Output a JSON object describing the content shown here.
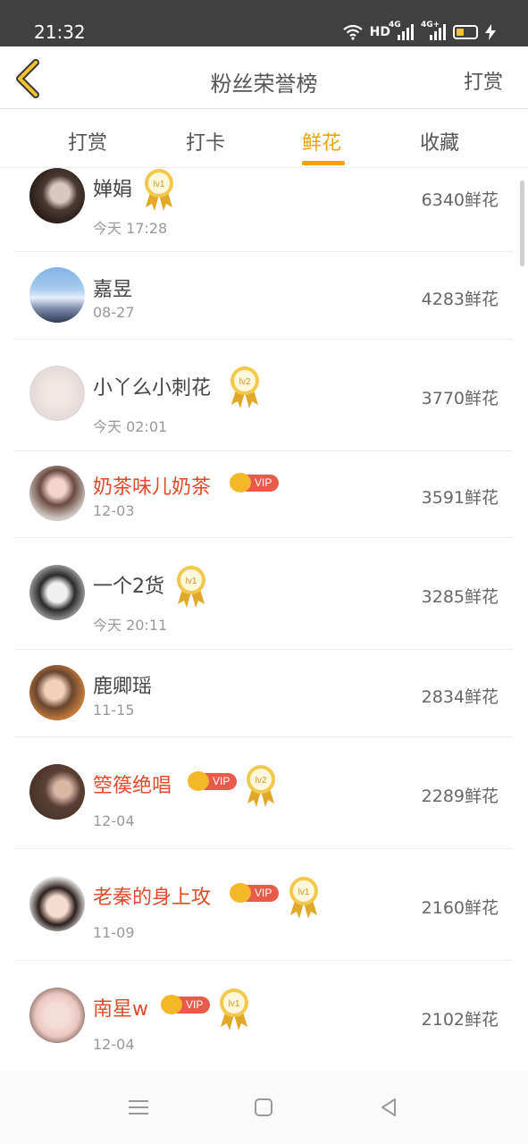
{
  "status_bar": {
    "time": "21:32",
    "hd": "HD",
    "sim1": "4G",
    "sim2": "4G+"
  },
  "header": {
    "title": "粉丝荣誉榜",
    "action": "打赏"
  },
  "tabs": [
    {
      "label": "打赏",
      "active": false
    },
    {
      "label": "打卡",
      "active": false
    },
    {
      "label": "鲜花",
      "active": true
    },
    {
      "label": "收藏",
      "active": false
    }
  ],
  "colors": {
    "accent": "#f0a30a",
    "vip_name": "#e04c2a",
    "vip_tag": "#e85a4a"
  },
  "fans": [
    {
      "name": "婵娟",
      "date": "今天 17:28",
      "score": "6340鲜花",
      "vip": false,
      "level": "lv1"
    },
    {
      "name": "嘉昱",
      "date": "08-27",
      "score": "4283鲜花",
      "vip": false,
      "level": ""
    },
    {
      "name": "小丫么小刺花",
      "date": "今天 02:01",
      "score": "3770鲜花",
      "vip": false,
      "level": "lv2"
    },
    {
      "name": "奶茶味儿奶茶",
      "date": "12-03",
      "score": "3591鲜花",
      "vip": true,
      "vip_label": "VIP",
      "level": ""
    },
    {
      "name": "一个2货",
      "date": "今天 20:11",
      "score": "3285鲜花",
      "vip": false,
      "level": "lv1"
    },
    {
      "name": "鹿卿瑶",
      "date": "11-15",
      "score": "2834鲜花",
      "vip": false,
      "level": ""
    },
    {
      "name": "箜篌绝唱",
      "date": "12-04",
      "score": "2289鲜花",
      "vip": true,
      "vip_label": "VIP",
      "level": "lv2"
    },
    {
      "name": "老秦的身上攻",
      "date": "11-09",
      "score": "2160鲜花",
      "vip": true,
      "vip_label": "VIP",
      "level": "lv1"
    },
    {
      "name": "南星w",
      "date": "12-04",
      "score": "2102鲜花",
      "vip": true,
      "vip_label": "VIP",
      "level": "lv1"
    }
  ]
}
